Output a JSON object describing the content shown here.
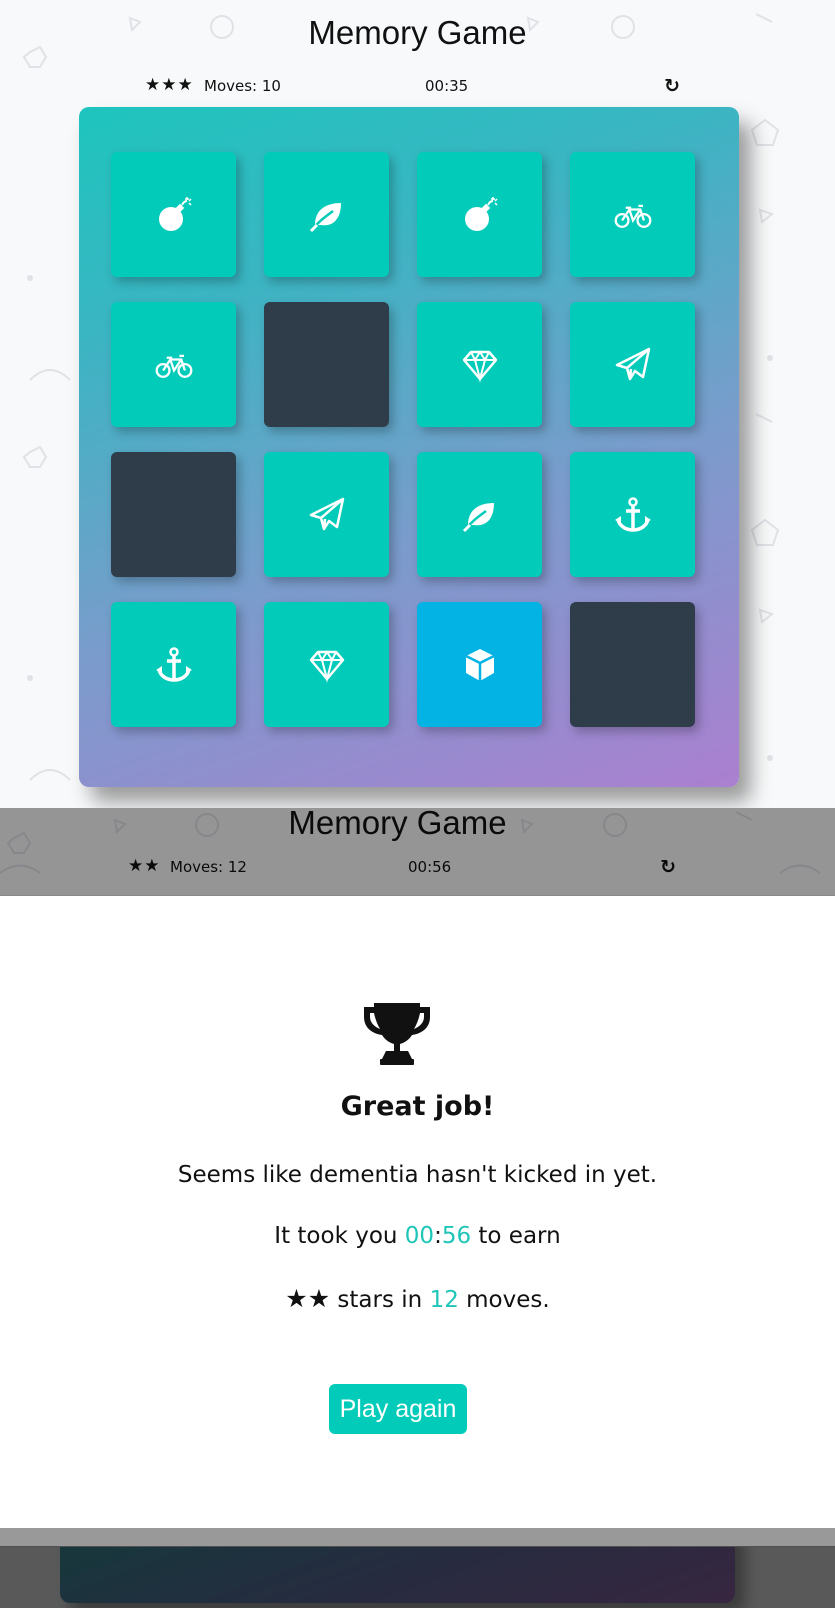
{
  "colors": {
    "card_open": "#03cbb9",
    "card_hidden": "#2e3d49",
    "card_active": "#02b3e4",
    "accent": "#1fc6b8",
    "button": "#03cbb9"
  },
  "game_top": {
    "title": "Memory Game",
    "stars": "★★★",
    "moves_text": "Moves: 10",
    "timer": "00:35",
    "restart_icon": "↻",
    "cards": [
      {
        "icon": "bomb-icon",
        "state": "open"
      },
      {
        "icon": "leaf-icon",
        "state": "open"
      },
      {
        "icon": "bomb-icon",
        "state": "open"
      },
      {
        "icon": "bicycle-icon",
        "state": "open"
      },
      {
        "icon": "bicycle-icon",
        "state": "open"
      },
      {
        "icon": "",
        "state": "hidden"
      },
      {
        "icon": "diamond-icon",
        "state": "open"
      },
      {
        "icon": "paper-plane-icon",
        "state": "open"
      },
      {
        "icon": "",
        "state": "hidden"
      },
      {
        "icon": "paper-plane-icon",
        "state": "open"
      },
      {
        "icon": "leaf-icon",
        "state": "open"
      },
      {
        "icon": "anchor-icon",
        "state": "open"
      },
      {
        "icon": "anchor-icon",
        "state": "open"
      },
      {
        "icon": "diamond-icon",
        "state": "open"
      },
      {
        "icon": "cube-icon",
        "state": "active"
      },
      {
        "icon": "",
        "state": "hidden"
      }
    ]
  },
  "game_bottom": {
    "title": "Memory Game",
    "stars": "★★",
    "moves_text": "Moves: 12",
    "timer": "00:56",
    "restart_icon": "↻"
  },
  "modal": {
    "icon": "trophy-icon",
    "heading": "Great job!",
    "message": "Seems like dementia hasn't kicked in yet.",
    "time_prefix": "It took you ",
    "time_minutes": "00",
    "time_sep": ":",
    "time_seconds": "56",
    "time_suffix": " to earn",
    "stars": "★★",
    "stars_text": " stars in ",
    "moves": "12",
    "moves_suffix": " moves.",
    "button_label": "Play again"
  }
}
